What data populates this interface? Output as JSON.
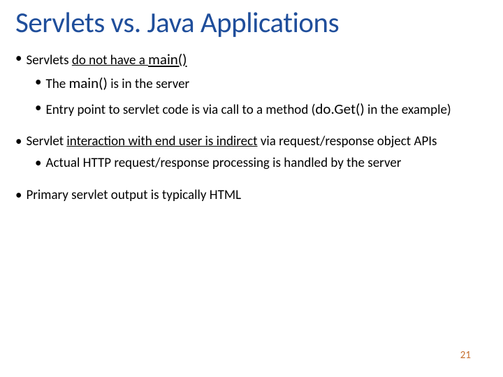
{
  "title": "Servlets vs. Java Applications",
  "bullets": {
    "b1_pre": "Servlets ",
    "b1_u": "do not have a ",
    "b1_code": "main()",
    "b2_pre": "The ",
    "b2_code": "main()",
    "b2_post": " is in the server",
    "b3_pre": "Entry point to servlet code is via call to a method (",
    "b3_code": "do.Get()",
    "b3_post": " in the example)",
    "b4_pre": "Servlet ",
    "b4_u": "interaction with end user is indirect",
    "b4_post": " via request/response object APIs",
    "b5": "Actual HTTP request/response processing is handled by the server",
    "b6": "Primary servlet output is typically HTML"
  },
  "page_number": "21"
}
